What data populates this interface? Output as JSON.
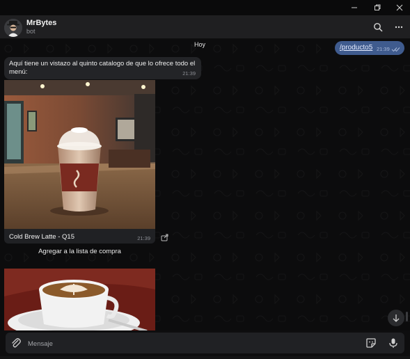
{
  "window": {
    "minimize_icon": "minimize-icon",
    "maximize_icon": "restore-icon",
    "close_icon": "close-icon"
  },
  "header": {
    "name": "MrBytes",
    "subtitle": "bot",
    "search_icon": "search-icon",
    "more_icon": "more-icon"
  },
  "chat": {
    "date_label": "Hoy",
    "outgoing": {
      "text": "/producto5",
      "time": "21:39"
    },
    "incoming_text": {
      "text": "Aquí tiene un vistazo al quinto catalogo de que lo ofrece todo el menú:",
      "time": "21:39"
    },
    "product": {
      "caption": "Cold Brew Latte - Q15",
      "time": "21:39"
    },
    "inline_button": "Agregar a la lista de compra"
  },
  "composer": {
    "placeholder": "Mensaje"
  },
  "colors": {
    "background": "#0c0c0d",
    "header": "#1f1f21",
    "outgoing_bubble": "#3f5b8e",
    "incoming_bubble": "#232427"
  }
}
